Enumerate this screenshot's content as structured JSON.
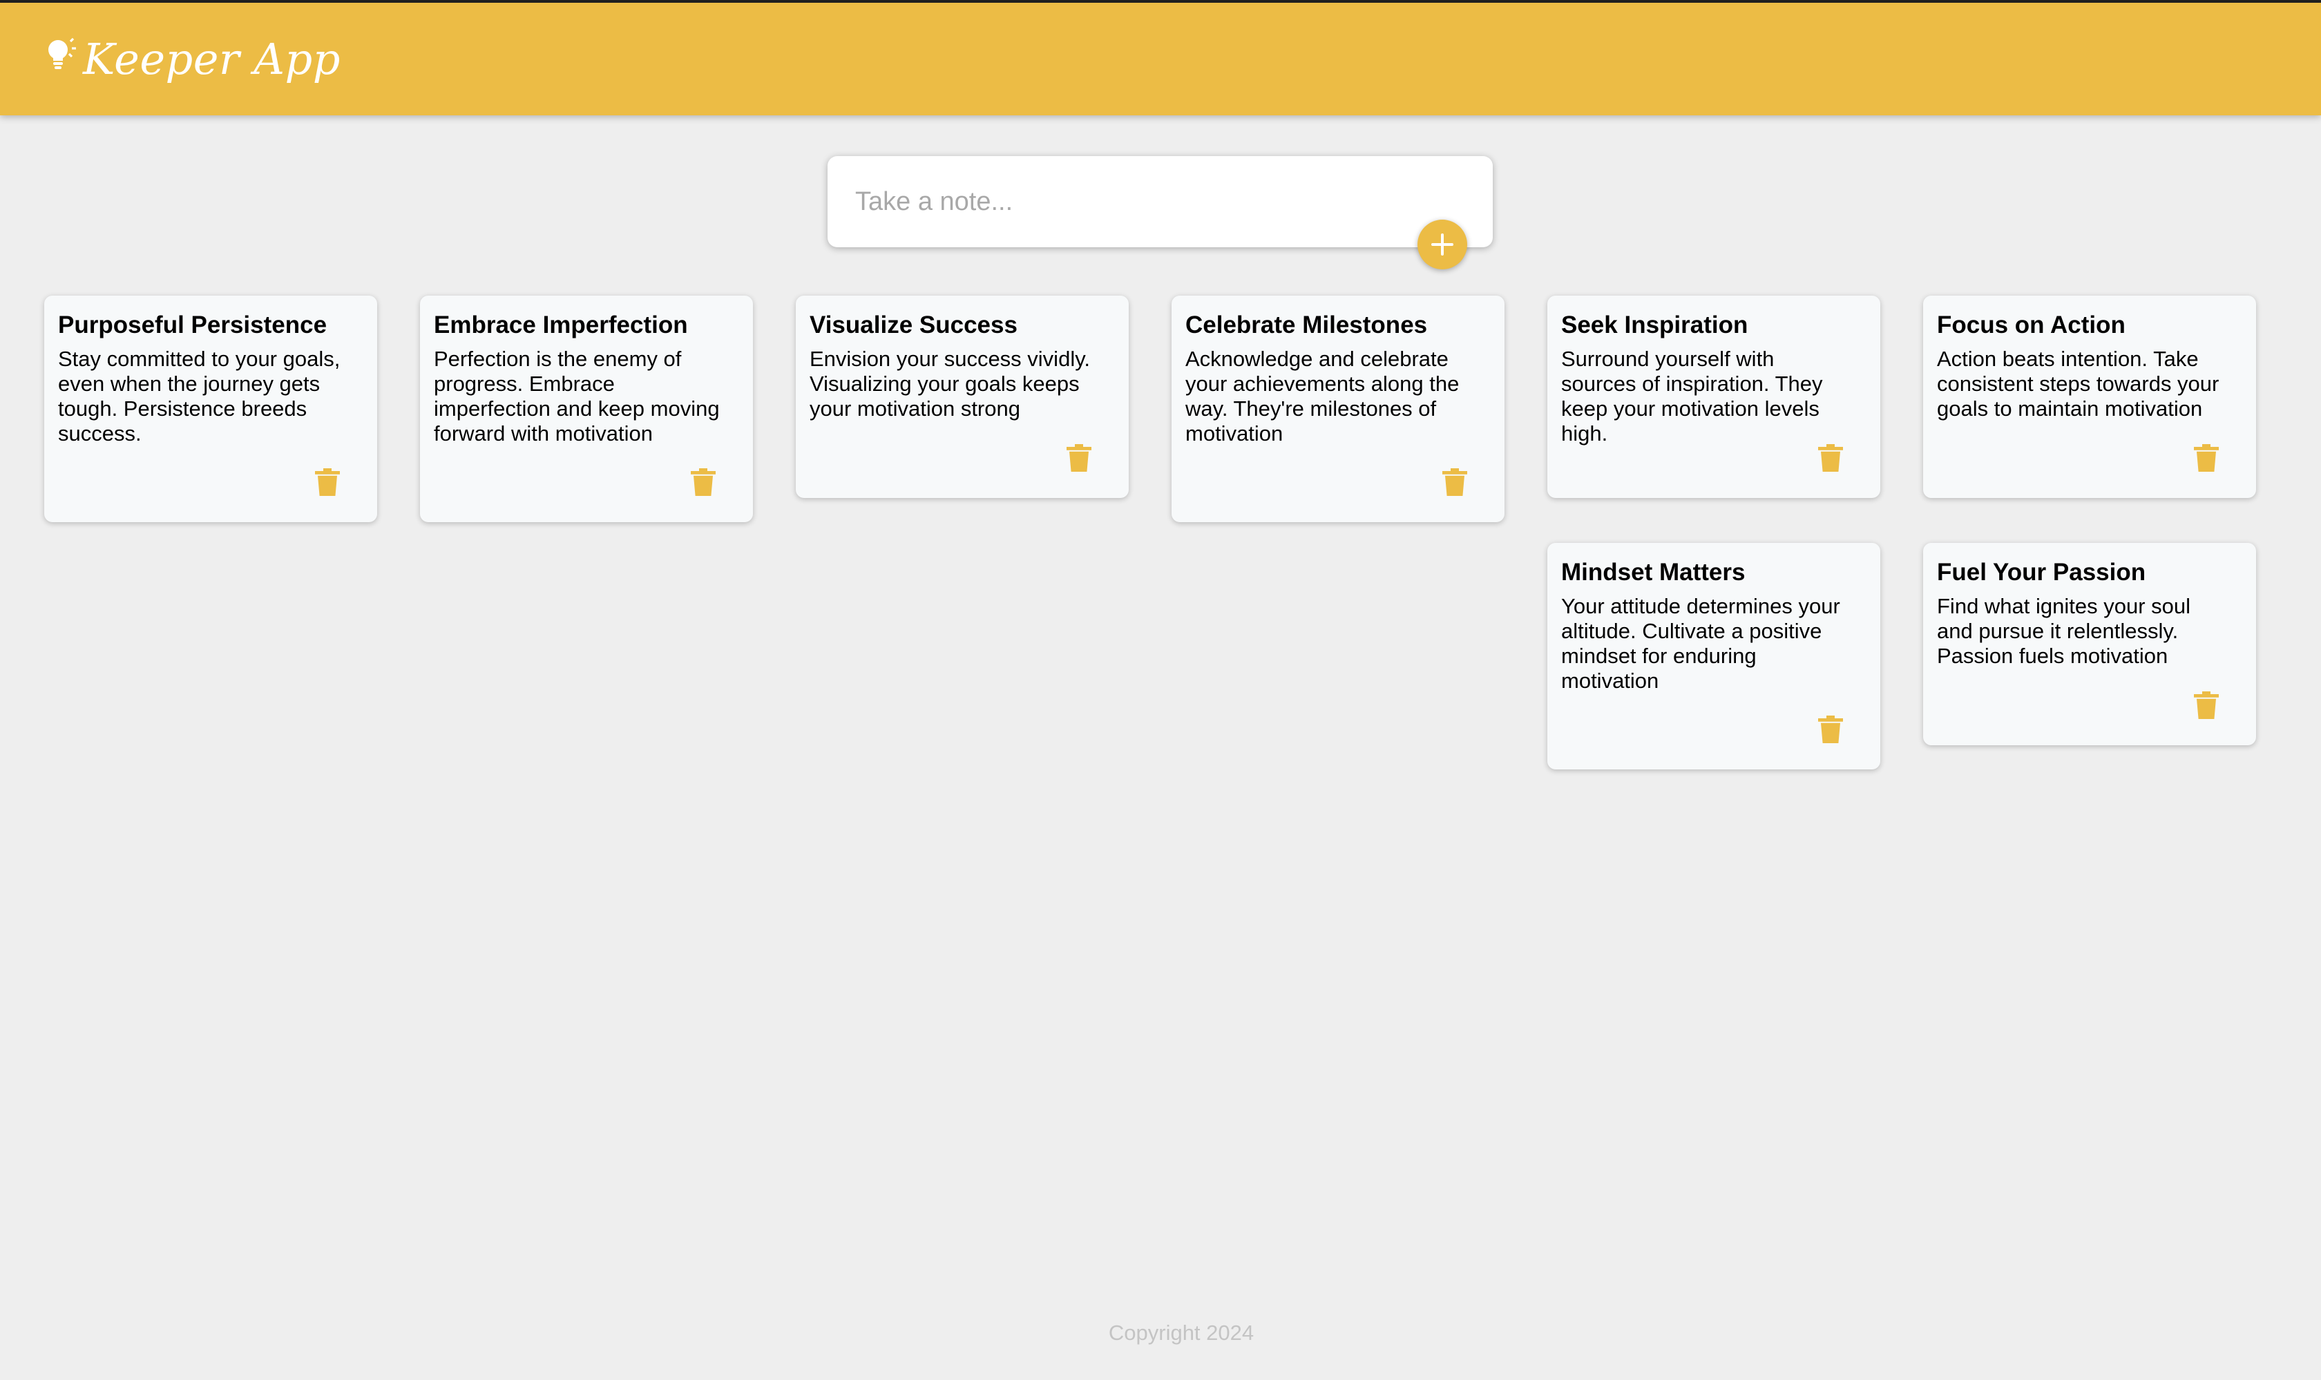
{
  "header": {
    "title": "Keeper App",
    "logo_icon": "lightbulb-icon",
    "color": "#ecbc45"
  },
  "create_area": {
    "placeholder": "Take a note...",
    "add_icon": "plus-icon"
  },
  "notes": [
    {
      "title": "Purposeful Persistence",
      "content": "Stay committed to your goals, even when the journey gets tough. Persistence breeds success."
    },
    {
      "title": "Embrace Imperfection",
      "content": "Perfection is the enemy of progress. Embrace imperfection and keep moving forward with motivation"
    },
    {
      "title": "Visualize Success",
      "content": "Envision your success vividly. Visualizing your goals keeps your motivation strong"
    },
    {
      "title": "Celebrate Milestones",
      "content": "Acknowledge and celebrate your achievements along the way. They're milestones of motivation"
    },
    {
      "title": "Seek Inspiration",
      "content": "Surround yourself with sources of inspiration. They keep your motivation levels high."
    },
    {
      "title": "Focus on Action",
      "content": "Action beats intention. Take consistent steps towards your goals to maintain motivation"
    },
    {
      "title": "Mindset Matters",
      "content": "Your attitude determines your altitude. Cultivate a positive mindset for enduring motivation"
    },
    {
      "title": "Fuel Your Passion",
      "content": "Find what ignites your soul and pursue it relentlessly. Passion fuels motivation"
    }
  ],
  "delete_icon": "trash-icon",
  "footer": {
    "text": "Copyright 2024"
  }
}
